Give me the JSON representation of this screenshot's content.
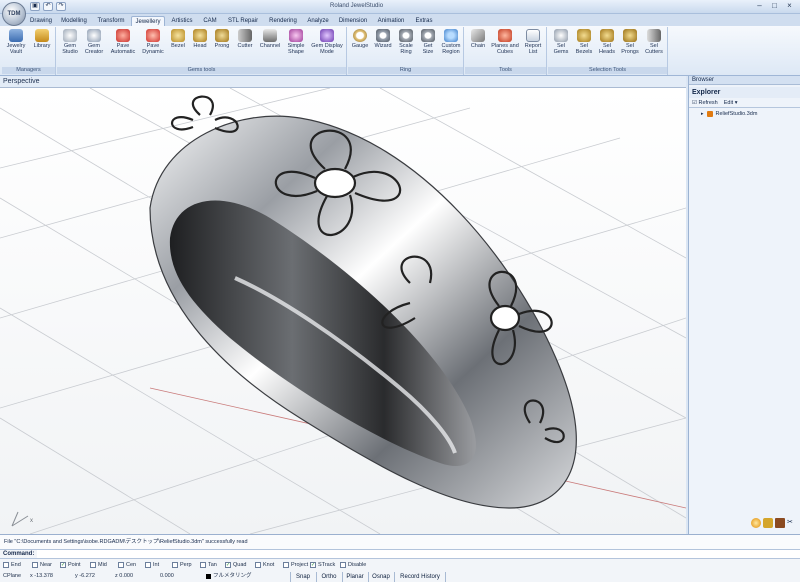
{
  "app": {
    "title": "Roland JewelStudio",
    "logo": "TDM"
  },
  "qat": [
    "disk-icon",
    "undo-icon",
    "redo-icon"
  ],
  "tabs": [
    "Drawing",
    "Modelling",
    "Transform",
    "Jewellery",
    "Artistics",
    "CAM",
    "STL Repair",
    "Rendering",
    "Analyze",
    "Dimension",
    "Animation",
    "Extras"
  ],
  "active_tab": "Jewellery",
  "ribbon": {
    "groups": {
      "managers": "Managers",
      "gems": "Gems tools",
      "ring": "Ring",
      "tools": "Tools",
      "selection": "Selection Tools"
    },
    "buttons": {
      "jewelry_vault": "Jewelry Vault",
      "library": "Library",
      "gem_studio": "Gem Studio",
      "gem_creator": "Gem Creator",
      "pave_auto": "Pave Automatic",
      "pave_dynamic": "Pave Dynamic",
      "bezel": "Bezel",
      "head": "Head",
      "prong": "Prong",
      "cutter": "Cutter",
      "channel": "Channel",
      "simple_shape": "Simple Shape",
      "gem_display": "Gem Display Mode",
      "gauge": "Gauge",
      "wizard": "Wizard",
      "scale_ring": "Scale Ring",
      "get_size": "Get Size",
      "custom_region": "Custom Region",
      "chain": "Chain",
      "planes_cubes": "Planes and Cubes",
      "report_list": "Report List",
      "sel_gems": "Sel Gems",
      "sel_bezels": "Sel Bezels",
      "sel_heads": "Sel Heads",
      "sel_prongs": "Sel Prongs",
      "sel_cutters": "Sel Cutters"
    }
  },
  "viewport": {
    "title": "Perspective"
  },
  "browser": {
    "title": "Browser",
    "explorer": "Explorer",
    "refresh": "Refresh",
    "edit": "Edit",
    "file": "ReliefStudio.3dm"
  },
  "command": {
    "history": "File \"C:\\Documents and Settings\\isobe.RDGADM\\デスクトップ\\ReliefStudio.3dm\" successfully read",
    "label": "Command:"
  },
  "osnaps": [
    {
      "label": "End",
      "checked": false
    },
    {
      "label": "Near",
      "checked": false
    },
    {
      "label": "Point",
      "checked": true
    },
    {
      "label": "Mid",
      "checked": false
    },
    {
      "label": "Cen",
      "checked": false
    },
    {
      "label": "Int",
      "checked": false
    },
    {
      "label": "Perp",
      "checked": false
    },
    {
      "label": "Tan",
      "checked": false
    },
    {
      "label": "Quad",
      "checked": true
    },
    {
      "label": "Knot",
      "checked": false
    },
    {
      "label": "Project",
      "checked": false
    },
    {
      "label": "STrack",
      "checked": true
    },
    {
      "label": "Disable",
      "checked": false
    }
  ],
  "status": {
    "cplane": "CPlane",
    "x": "x -13.378",
    "y": "y -6.272",
    "z": "z 0.000",
    "value": "0.000",
    "layer": "フルメタリング",
    "buttons": [
      "Snap",
      "Ortho",
      "Planar",
      "Osnap",
      "Record History"
    ]
  },
  "colors": {
    "ribbon_bg": "#dde8f5",
    "accent": "#f0a020",
    "ring_metal": "#b8bcc2"
  }
}
